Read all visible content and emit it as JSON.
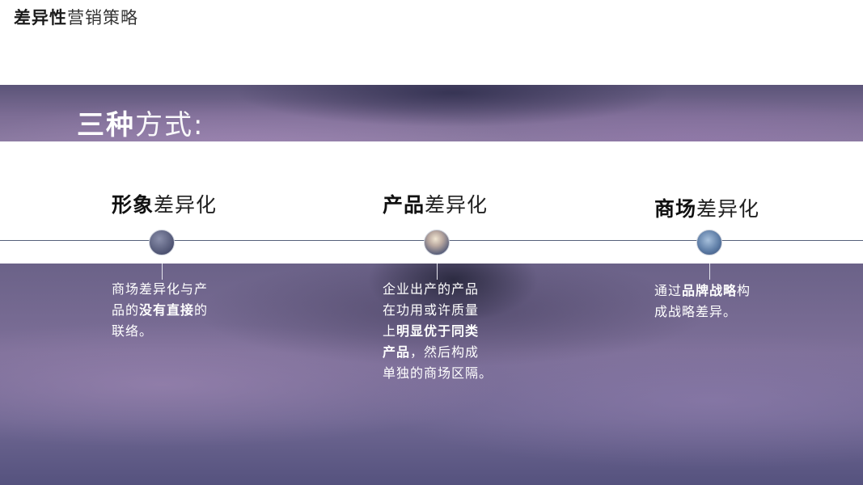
{
  "page_title": {
    "bold": "差异性",
    "light": "营销策略"
  },
  "band": {
    "bold": "三种",
    "light": "方式:"
  },
  "columns": [
    {
      "title_bold": "形象",
      "title_light": "差异化",
      "desc": [
        {
          "text": "商场差异化与产",
          "bold": false
        },
        {
          "text": "品的",
          "bold": false
        },
        {
          "text": "没有直接",
          "bold": true
        },
        {
          "text": "的",
          "bold": false
        },
        {
          "text": "联络。",
          "bold": false
        }
      ]
    },
    {
      "title_bold": "产品",
      "title_light": "差异化",
      "desc": [
        {
          "text": "企业出产的产品",
          "bold": false
        },
        {
          "text": "在功用或许质量",
          "bold": false
        },
        {
          "text": "上",
          "bold": false
        },
        {
          "text": "明显优于同类",
          "bold": true
        },
        {
          "text": "产品",
          "bold": true
        },
        {
          "text": "，然后构成",
          "bold": false
        },
        {
          "text": "单独的商场区隔。",
          "bold": false
        }
      ]
    },
    {
      "title_bold": "商场",
      "title_light": "差异化",
      "desc": [
        {
          "text": "通过",
          "bold": false
        },
        {
          "text": "品牌战略",
          "bold": true
        },
        {
          "text": "构",
          "bold": false
        },
        {
          "text": "成战略差异。",
          "bold": false
        }
      ]
    }
  ]
}
